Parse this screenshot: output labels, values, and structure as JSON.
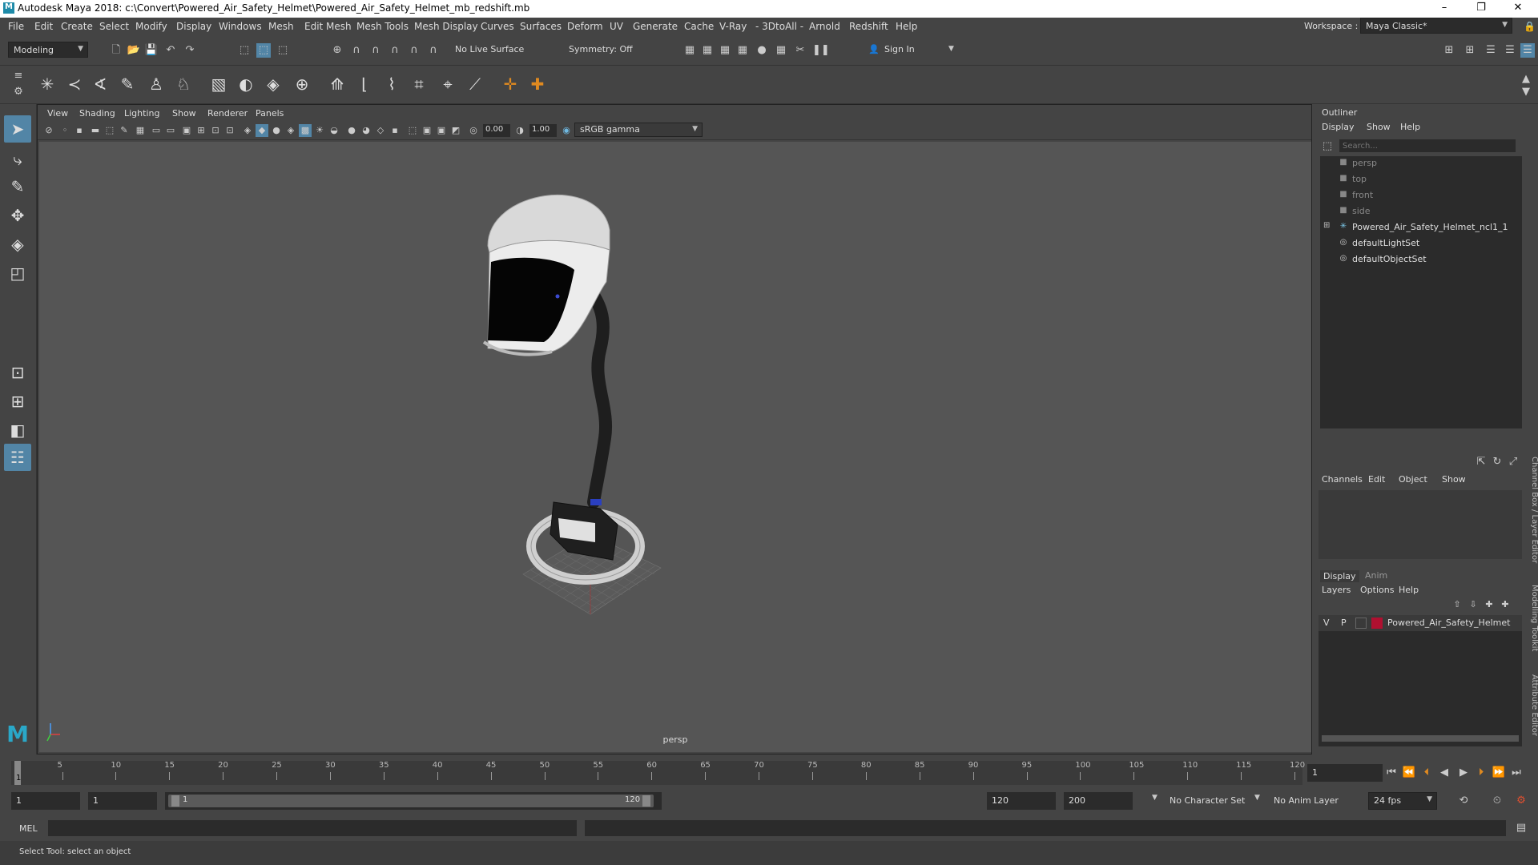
{
  "titlebar": {
    "title": "Autodesk Maya 2018: c:\\Convert\\Powered_Air_Safety_Helmet\\Powered_Air_Safety_Helmet_mb_redshift.mb",
    "minimize": "–",
    "maximize": "❐",
    "close": "✕"
  },
  "menubar": {
    "items": [
      "File",
      "Edit",
      "Create",
      "Select",
      "Modify",
      "Display",
      "Windows",
      "Mesh",
      "Edit Mesh",
      "Mesh Tools",
      "Mesh Display",
      "Curves",
      "Surfaces",
      "Deform",
      "UV",
      "Generate",
      "Cache",
      "V-Ray",
      "- 3DtoAll -",
      "Arnold",
      "Redshift",
      "Help"
    ],
    "workspace_label": "Workspace :",
    "workspace_value": "Maya Classic*"
  },
  "statusline": {
    "mode": "Modeling",
    "live_surface": "No Live Surface",
    "symmetry": "Symmetry: Off",
    "sign_in": "Sign In"
  },
  "panel": {
    "menus": [
      "View",
      "Shading",
      "Lighting",
      "Show",
      "Renderer",
      "Panels"
    ],
    "exposure": "0.00",
    "gamma": "1.00",
    "colorspace": "sRGB gamma",
    "camera_label": "persp"
  },
  "outliner": {
    "title": "Outliner",
    "menus": [
      "Display",
      "Show",
      "Help"
    ],
    "search_placeholder": "Search...",
    "items": [
      {
        "label": "persp",
        "icon": "camera-icon",
        "dim": true
      },
      {
        "label": "top",
        "icon": "camera-icon",
        "dim": true
      },
      {
        "label": "front",
        "icon": "camera-icon",
        "dim": true
      },
      {
        "label": "side",
        "icon": "camera-icon",
        "dim": true
      },
      {
        "label": "Powered_Air_Safety_Helmet_ncl1_1",
        "icon": "transform-icon",
        "dim": false
      },
      {
        "label": "defaultLightSet",
        "icon": "set-icon",
        "dim": false
      },
      {
        "label": "defaultObjectSet",
        "icon": "set-icon",
        "dim": false
      }
    ]
  },
  "channelbox": {
    "menus": [
      "Channels",
      "Edit",
      "Object",
      "Show"
    ]
  },
  "layereditor": {
    "tabs": [
      "Display",
      "Anim"
    ],
    "menus": [
      "Layers",
      "Options",
      "Help"
    ],
    "layer": {
      "v": "V",
      "p": "P",
      "name": "Powered_Air_Safety_Helmet",
      "color": "#b01030"
    }
  },
  "sidetabs": [
    "Channel Box / Layer Editor",
    "Modelling Toolkit",
    "Attribute Editor"
  ],
  "timeslider": {
    "ticks": [
      "5",
      "10",
      "15",
      "20",
      "25",
      "30",
      "35",
      "40",
      "45",
      "50",
      "55",
      "60",
      "65",
      "70",
      "75",
      "80",
      "85",
      "90",
      "95",
      "100",
      "105",
      "110",
      "115",
      "120"
    ],
    "current": "1",
    "current_field": "1"
  },
  "range": {
    "start": "1",
    "inner_start": "1",
    "slider_start": "1",
    "slider_end": "120",
    "end": "120",
    "total_end": "200",
    "character_set": "No Character Set",
    "anim_layer": "No Anim Layer",
    "fps": "24 fps"
  },
  "cmdline": {
    "label": "MEL"
  },
  "helpline": {
    "text": "Select Tool: select an object"
  }
}
